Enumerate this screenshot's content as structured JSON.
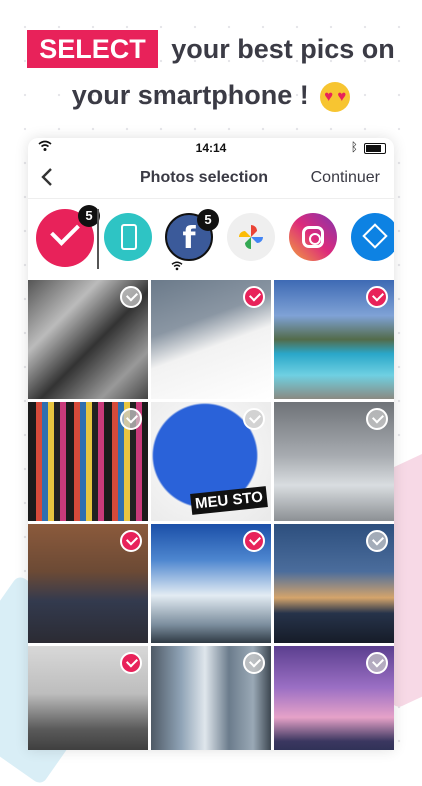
{
  "headline": {
    "highlight": "SELECT",
    "line1_rest": "your best pics on",
    "line2": "your smartphone !",
    "emoji": "heart-eyes-emoji"
  },
  "statusbar": {
    "time": "14:14"
  },
  "navbar": {
    "back_icon": "chevron-left-icon",
    "title": "Photos selection",
    "continue_label": "Continuer"
  },
  "sources": {
    "selected_count": "5",
    "facebook_count": "5",
    "items": [
      "selected",
      "phone",
      "facebook",
      "google-photos",
      "instagram",
      "dropbox"
    ]
  },
  "colors": {
    "accent": "#e8225a",
    "phone": "#2ec4c4",
    "facebook": "#3b5a9a",
    "dropbox": "#0d82e3"
  },
  "photos": [
    {
      "name": "graffiti",
      "selected": false
    },
    {
      "name": "snowy-mountain",
      "selected": true
    },
    {
      "name": "infinity-pool",
      "selected": true
    },
    {
      "name": "ski-rack",
      "selected": false
    },
    {
      "name": "usa-map",
      "selected": false,
      "overlay": "MEU STO"
    },
    {
      "name": "mountain-clouds",
      "selected": false
    },
    {
      "name": "group-cabin",
      "selected": true
    },
    {
      "name": "climber-sky",
      "selected": true
    },
    {
      "name": "dusk-harbor",
      "selected": false
    },
    {
      "name": "skiers-bw",
      "selected": true
    },
    {
      "name": "city-towers",
      "selected": false
    },
    {
      "name": "toronto-skyline",
      "selected": false
    }
  ]
}
